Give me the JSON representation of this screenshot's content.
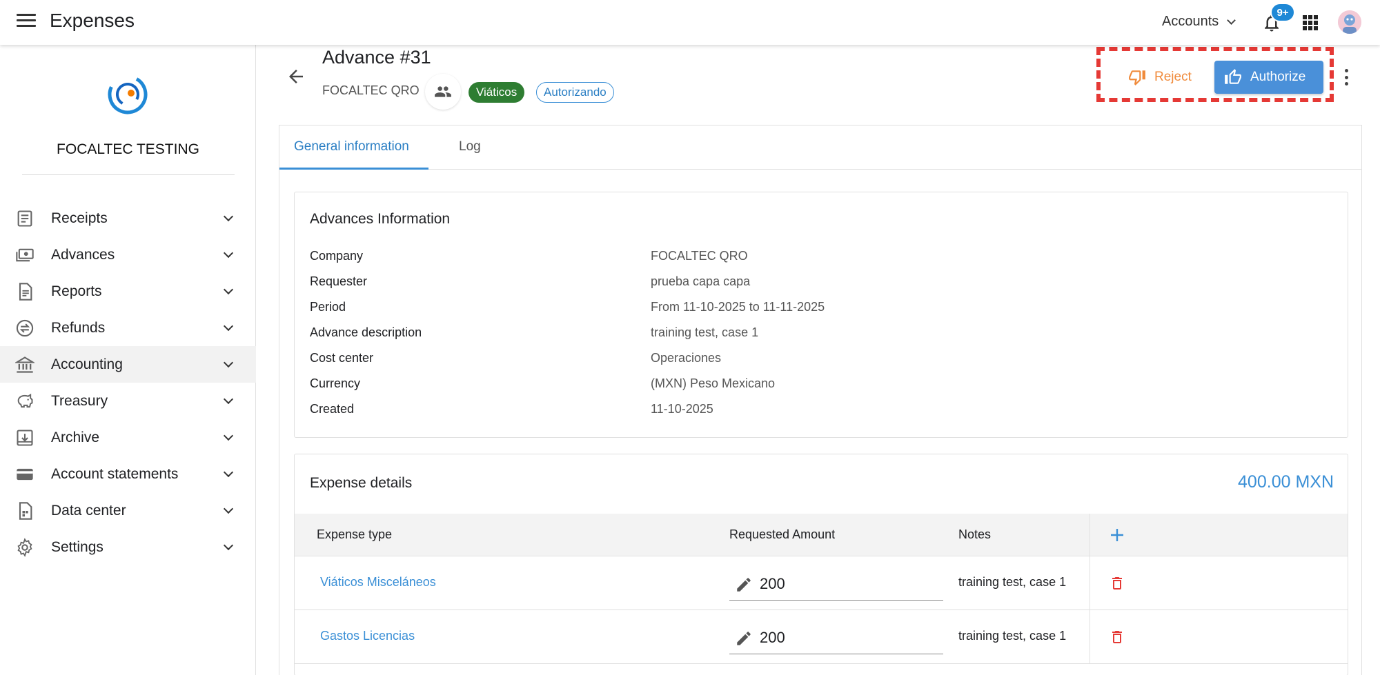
{
  "header": {
    "app_title": "Expenses",
    "accounts_label": "Accounts",
    "notification_badge": "9+"
  },
  "sidebar": {
    "org_name": "FOCALTEC TESTING",
    "items": [
      {
        "label": "Receipts",
        "icon": "receipt-icon"
      },
      {
        "label": "Advances",
        "icon": "cash-icon"
      },
      {
        "label": "Reports",
        "icon": "report-icon"
      },
      {
        "label": "Refunds",
        "icon": "refund-icon"
      },
      {
        "label": "Accounting",
        "icon": "bank-icon"
      },
      {
        "label": "Treasury",
        "icon": "piggy-bank-icon"
      },
      {
        "label": "Archive",
        "icon": "archive-icon"
      },
      {
        "label": "Account statements",
        "icon": "card-icon"
      },
      {
        "label": "Data center",
        "icon": "data-icon"
      },
      {
        "label": "Settings",
        "icon": "gear-icon"
      }
    ]
  },
  "advance": {
    "title": "Advance #31",
    "company": "FOCALTEC QRO",
    "category_chip": "Viáticos",
    "status_chip": "Autorizando"
  },
  "actions": {
    "reject_label": "Reject",
    "authorize_label": "Authorize"
  },
  "tabs": [
    {
      "label": "General information"
    },
    {
      "label": "Log"
    }
  ],
  "advances_info": {
    "title": "Advances Information",
    "rows": [
      {
        "label": "Company",
        "value": "FOCALTEC QRO"
      },
      {
        "label": "Requester",
        "value": "prueba capa capa"
      },
      {
        "label": "Period",
        "value": "From 11-10-2025 to 11-11-2025"
      },
      {
        "label": "Advance description",
        "value": "training test, case 1"
      },
      {
        "label": "Cost center",
        "value": "Operaciones"
      },
      {
        "label": "Currency",
        "value": "(MXN) Peso Mexicano"
      },
      {
        "label": "Created",
        "value": "11-10-2025"
      }
    ]
  },
  "expense_details": {
    "title": "Expense details",
    "total": "400.00 MXN",
    "columns": {
      "type": "Expense type",
      "amount": "Requested Amount",
      "notes": "Notes"
    },
    "rows": [
      {
        "type": "Viáticos Misceláneos",
        "amount": "200",
        "notes": "training test, case 1"
      },
      {
        "type": "Gastos Licencias",
        "amount": "200",
        "notes": "training test, case 1"
      }
    ]
  },
  "colors": {
    "accent": "#3a8fd6",
    "chip_green": "#2e7d32",
    "reject": "#f08a3a",
    "delete": "#e53935",
    "highlight": "#e53935"
  }
}
